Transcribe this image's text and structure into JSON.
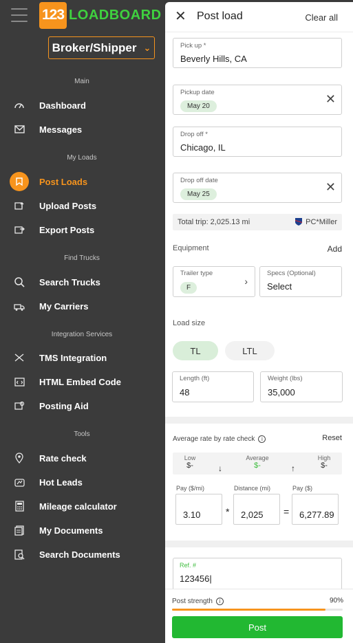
{
  "brand": {
    "number": "123",
    "name": "LOADBOARD"
  },
  "role_select": {
    "value": "Broker/Shipper"
  },
  "sidebar": {
    "sections": {
      "main": "Main",
      "my_loads": "My Loads",
      "find_trucks": "Find Trucks",
      "integration": "Integration Services",
      "tools": "Tools"
    },
    "items": {
      "dashboard": "Dashboard",
      "messages": "Messages",
      "post_loads": "Post Loads",
      "upload_posts": "Upload Posts",
      "export_posts": "Export Posts",
      "search_trucks": "Search Trucks",
      "my_carriers": "My Carriers",
      "tms_integration": "TMS Integration",
      "html_embed": "HTML Embed Code",
      "posting_aid": "Posting Aid",
      "rate_check": "Rate check",
      "hot_leads": "Hot Leads",
      "mileage_calculator": "Mileage calculator",
      "my_documents": "My Documents",
      "search_documents": "Search Documents"
    },
    "active_item": "post_loads"
  },
  "panel": {
    "title": "Post load",
    "clear_all": "Clear all",
    "pickup": {
      "label": "Pick up *",
      "value": "Beverly Hills, CA"
    },
    "pickup_date": {
      "label": "Pickup date",
      "value": "May 20"
    },
    "dropoff": {
      "label": "Drop off *",
      "value": "Chicago, IL"
    },
    "dropoff_date": {
      "label": "Drop off date",
      "value": "May 25"
    },
    "total_trip": "Total trip: 2,025.13 mi",
    "pcmiler": "PC*Miller",
    "equipment_label": "Equipment",
    "add_label": "Add",
    "trailer_type": {
      "label": "Trailer type",
      "value": "F"
    },
    "specs": {
      "label": "Specs (Optional)",
      "value": "Select"
    },
    "load_size_label": "Load size",
    "load_size_options": [
      "TL",
      "LTL"
    ],
    "load_size_selected": "TL",
    "length": {
      "label": "Length (ft)",
      "value": "48"
    },
    "weight": {
      "label": "Weight (lbs)",
      "value": "35,000"
    },
    "rate_check": {
      "title": "Average rate by rate check",
      "reset": "Reset",
      "low_label": "Low",
      "low_value": "$-",
      "avg_label": "Average",
      "avg_value": "$-",
      "high_label": "High",
      "high_value": "$-"
    },
    "calc": {
      "pay_per_mile_label": "Pay ($/mi)",
      "pay_per_mile": "3.10",
      "distance_label": "Distance (mi)",
      "distance": "2,025",
      "pay_label": "Pay ($)",
      "pay": "6,277.89",
      "times": "*",
      "equals": "="
    },
    "ref": {
      "label": "Ref. #",
      "value": "123456|"
    },
    "post_strength": {
      "label": "Post strength",
      "percent_text": "90%",
      "fraction": 0.9
    },
    "post_button": "Post"
  },
  "colors": {
    "accent": "#f7941d",
    "brand_green": "#3fd13f",
    "post_green": "#22b832"
  }
}
